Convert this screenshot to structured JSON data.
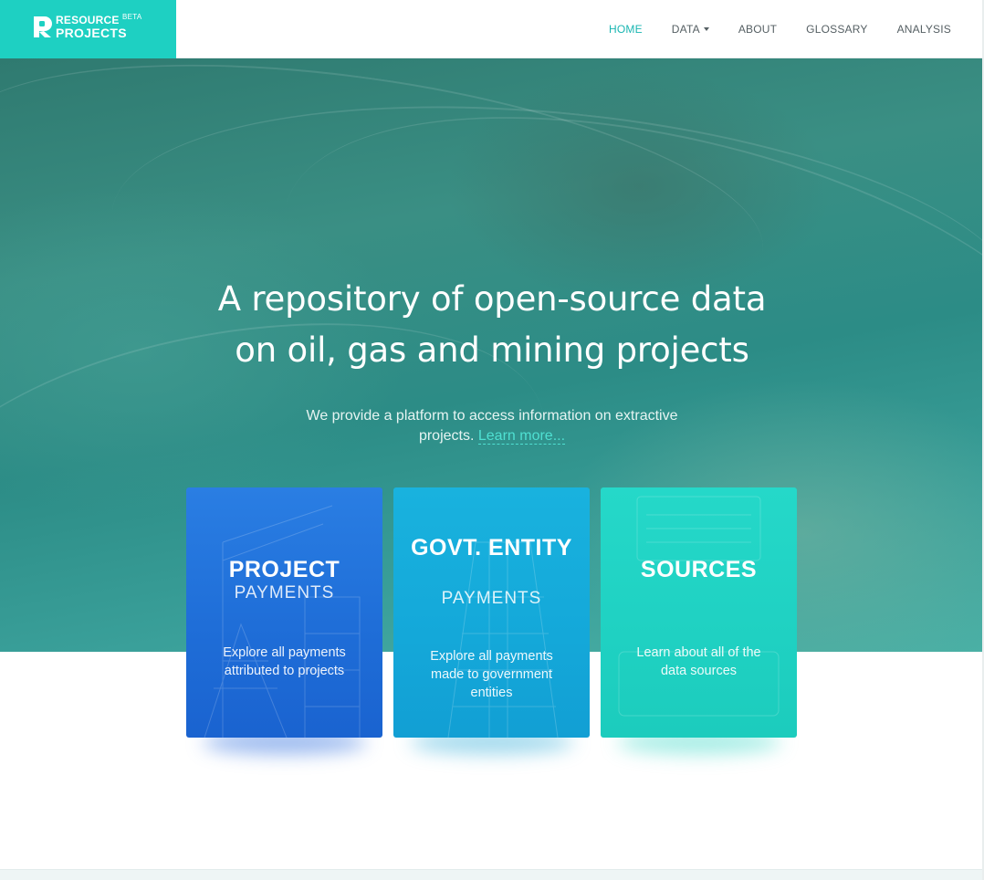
{
  "brand": {
    "line1": "RESOURCE",
    "line2": "PROJECTS",
    "badge": "BETA",
    "logo_icon": "resource-projects-logo-icon",
    "color": "#1ed0c2"
  },
  "nav": {
    "items": [
      {
        "label": "HOME",
        "active": true
      },
      {
        "label": "DATA",
        "dropdown": true
      },
      {
        "label": "ABOUT"
      },
      {
        "label": "GLOSSARY"
      },
      {
        "label": "ANALYSIS"
      }
    ],
    "active_color": "#1ab6b2"
  },
  "hero": {
    "title_line1": "A repository of open-source data",
    "title_line2": "on oil, gas and mining projects",
    "subtitle": "We provide a platform to access information on extractive projects.",
    "learn_more": "Learn more..."
  },
  "cards": [
    {
      "heading": "PROJECT",
      "subheading": "PAYMENTS",
      "description": "Explore all payments attributed to projects",
      "color": "#1f6ed8"
    },
    {
      "heading": "GOVT. ENTITY",
      "subheading": "PAYMENTS",
      "description": "Explore all payments made to government entities",
      "color": "#14a8d9"
    },
    {
      "heading": "SOURCES",
      "subheading": "",
      "description": "Learn about all of the data sources",
      "color": "#1fd1c2"
    }
  ]
}
